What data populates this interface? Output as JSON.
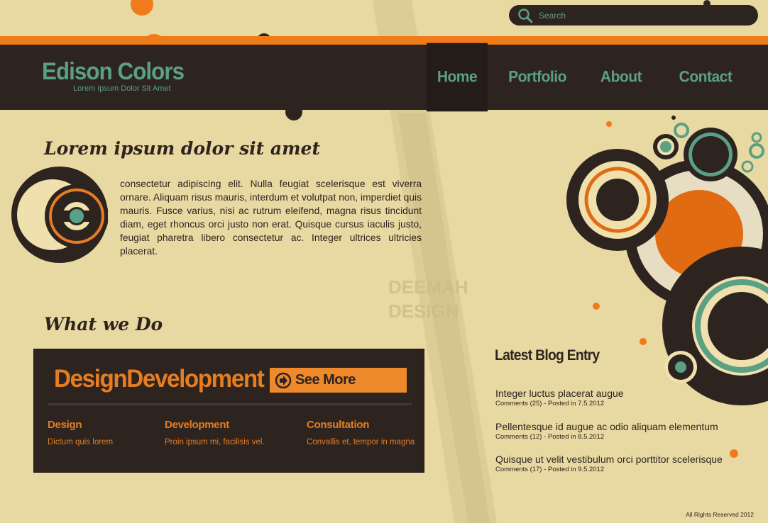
{
  "search": {
    "placeholder": "Search"
  },
  "logo": {
    "title": "Edison Colors",
    "subtitle": "Lorem Ipsum Dolor Sit Amet"
  },
  "nav": {
    "items": [
      {
        "label": "Home"
      },
      {
        "label": "Portfolio"
      },
      {
        "label": "About"
      },
      {
        "label": "Contact"
      }
    ]
  },
  "intro": {
    "heading": "Lorem ipsum dolor sit amet",
    "text": "consectetur adipiscing elit. Nulla feugiat scelerisque est viverra ornare. Aliquam risus mauris, interdum et volutpat non, imperdiet quis mauris. Fusce varius, nisi ac rutrum eleifend, magna risus tincidunt diam, eget rhoncus orci justo non erat. Quisque cursus iaculis justo, feugiat pharetra libero consectetur ac. Integer ultrices ultricies placerat."
  },
  "what_we_do": {
    "heading": "What we Do",
    "panel_title": "DesignDevelopment",
    "see_more": "See More",
    "services": [
      {
        "title": "Design",
        "desc": "Dictum quis lorem"
      },
      {
        "title": "Development",
        "desc": "Proin ipsum mi, facilisis vel."
      },
      {
        "title": "Consultation",
        "desc": "Convallis et, tempor in magna"
      }
    ]
  },
  "watermark": {
    "line1": "DEEMAH",
    "line2": "DESIGN"
  },
  "blog": {
    "heading": "Latest Blog Entry",
    "entries": [
      {
        "title": "Integer luctus placerat augue",
        "meta": "Comments (25) - Posted in 7.5.2012"
      },
      {
        "title": "Pellentesque id augue ac odio aliquam elementum",
        "meta": "Comments (12) - Posted in 8.5.2012"
      },
      {
        "title": "Quisque ut velit vestibulum orci porttitor scelerisque",
        "meta": "Comments (17) - Posted in 9.5.2012"
      }
    ]
  },
  "footer": {
    "text": "All Rights Reserved 2012"
  },
  "colors": {
    "dark": "#2e241f",
    "orange": "#f07b1b",
    "teal": "#5aa084",
    "cream": "#e8d9a2"
  }
}
